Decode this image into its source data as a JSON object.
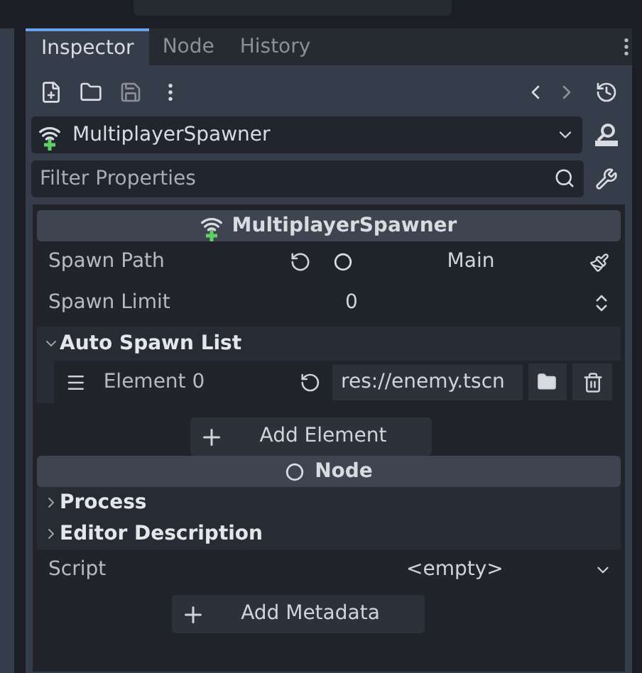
{
  "tabs": [
    {
      "label": "Inspector",
      "selected": true
    },
    {
      "label": "Node",
      "selected": false
    },
    {
      "label": "History",
      "selected": false
    }
  ],
  "object_selector": {
    "value": "MultiplayerSpawner"
  },
  "filter": {
    "placeholder": "Filter Properties"
  },
  "class_header": "MultiplayerSpawner",
  "properties": [
    {
      "kind": "path",
      "label": "Spawn Path",
      "value": "Main"
    },
    {
      "kind": "spin",
      "label": "Spawn Limit",
      "value": "0"
    }
  ],
  "auto_spawn_group": {
    "label": "Auto Spawn List",
    "expanded": true,
    "elements": [
      {
        "label": "Element 0",
        "value": "res://enemy.tscn"
      }
    ],
    "add_button": "Add Element"
  },
  "node_header": "Node",
  "groups": [
    {
      "label": "Process",
      "expanded": false
    },
    {
      "label": "Editor Description",
      "expanded": false
    }
  ],
  "script": {
    "label": "Script",
    "value": "<empty>"
  },
  "add_metadata": "Add Metadata"
}
